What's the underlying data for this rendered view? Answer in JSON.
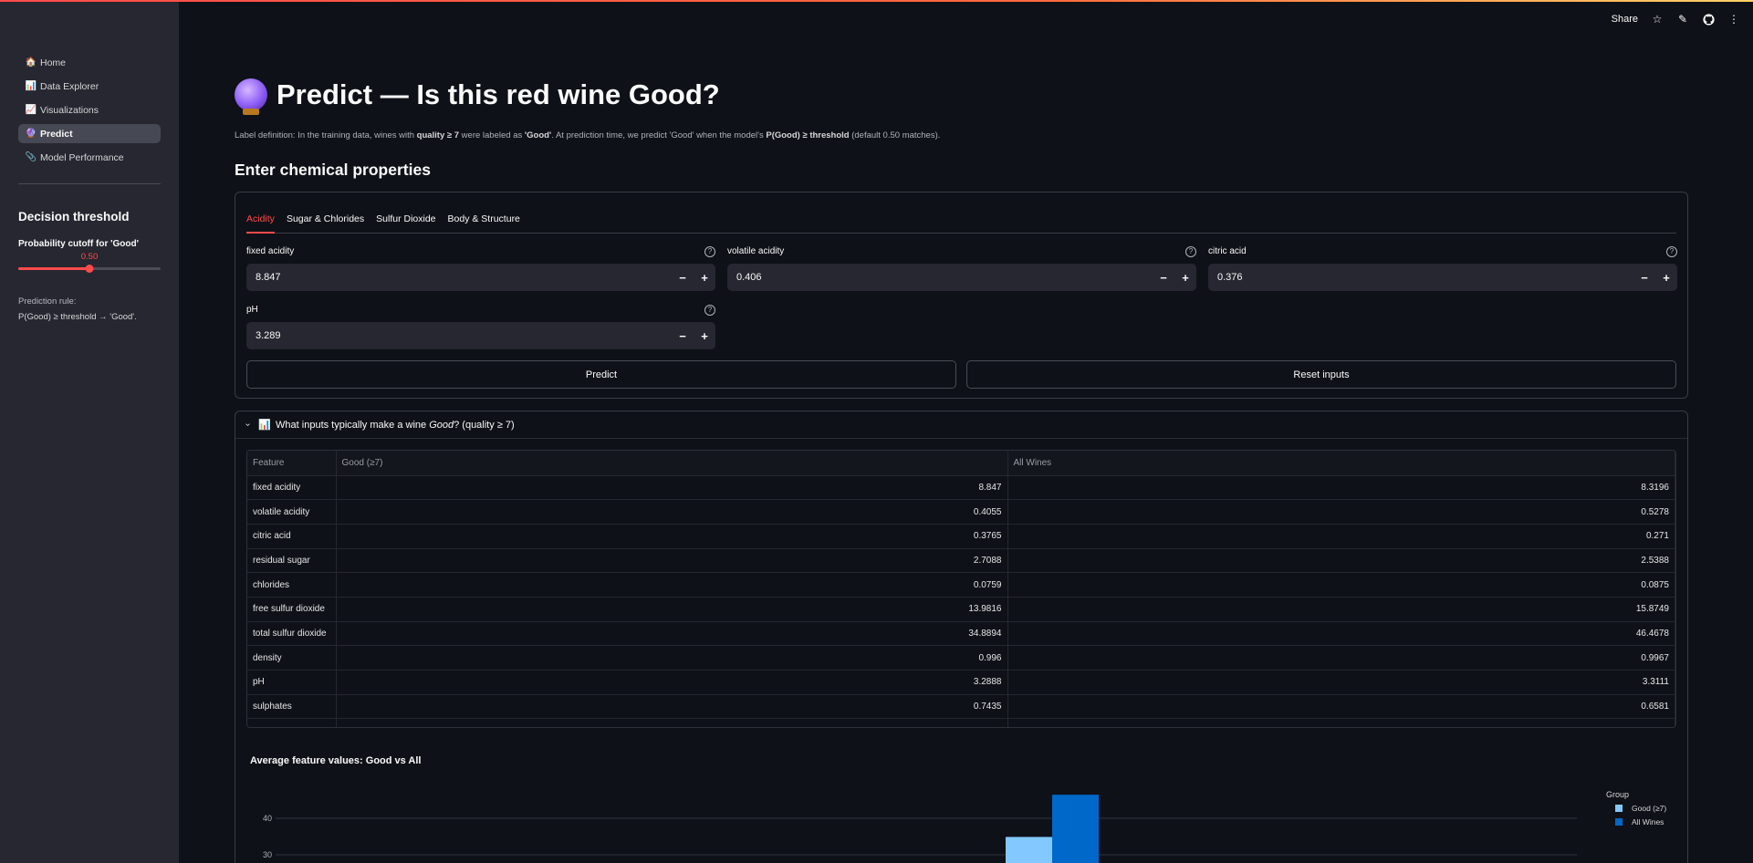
{
  "sidebar": {
    "nav": [
      {
        "label": "Home",
        "icon": "🏠",
        "active": false
      },
      {
        "label": "Data Explorer",
        "icon": "📊",
        "active": false
      },
      {
        "label": "Visualizations",
        "icon": "📈",
        "active": false
      },
      {
        "label": "Predict",
        "icon": "🔮",
        "active": true
      },
      {
        "label": "Model Performance",
        "icon": "📎",
        "active": false
      }
    ],
    "heading": "Decision threshold",
    "slider_label": "Probability cutoff for 'Good'",
    "slider_value": "0.50",
    "slider_fraction": 0.5,
    "rule_label": "Prediction rule:",
    "rule_text": "P(Good) ≥ threshold → 'Good'."
  },
  "toolbar": {
    "share_label": "Share"
  },
  "main": {
    "title": "Predict — Is this red wine Good?",
    "label_def": {
      "p1": "Label definition: In the training data, wines with ",
      "b1": "quality ≥ 7",
      "p2": " were labeled as ",
      "b2": "'Good'",
      "p3": ". At prediction time, we predict 'Good' when the model's ",
      "b3": "P(Good) ≥ threshold",
      "p4": " (default 0.50 matches)."
    },
    "section_heading": "Enter chemical properties",
    "tabs": [
      "Acidity",
      "Sugar & Chlorides",
      "Sulfur Dioxide",
      "Body & Structure"
    ],
    "fields": [
      {
        "label": "fixed acidity",
        "value": "8.847"
      },
      {
        "label": "volatile acidity",
        "value": "0.406"
      },
      {
        "label": "citric acid",
        "value": "0.376"
      },
      {
        "label": "pH",
        "value": "3.289"
      }
    ],
    "predict_label": "Predict",
    "reset_label": "Reset inputs",
    "expander": {
      "icon": "📊",
      "p1": "What inputs typically make a wine ",
      "em": "Good",
      "p2": "? (quality ≥ 7)"
    },
    "table": {
      "headers": [
        "Feature",
        "Good (≥7)",
        "All Wines"
      ],
      "rows": [
        [
          "fixed acidity",
          "8.847",
          "8.3196"
        ],
        [
          "volatile acidity",
          "0.4055",
          "0.5278"
        ],
        [
          "citric acid",
          "0.3765",
          "0.271"
        ],
        [
          "residual sugar",
          "2.7088",
          "2.5388"
        ],
        [
          "chlorides",
          "0.0759",
          "0.0875"
        ],
        [
          "free sulfur dioxide",
          "13.9816",
          "15.8749"
        ],
        [
          "total sulfur dioxide",
          "34.8894",
          "46.4678"
        ],
        [
          "density",
          "0.996",
          "0.9967"
        ],
        [
          "pH",
          "3.2888",
          "3.3111"
        ],
        [
          "sulphates",
          "0.7435",
          "0.6581"
        ]
      ]
    },
    "chart_title": "Average feature values: Good vs All"
  },
  "chart_data": {
    "type": "bar",
    "title": "Average feature values: Good vs All",
    "y_ticks": [
      "40",
      "30"
    ],
    "visible_bars": [
      {
        "series": "Good (≥7)",
        "value": 34.8894
      },
      {
        "series": "All Wines",
        "value": 46.4678
      }
    ],
    "series": [
      {
        "name": "Good (≥7)",
        "color": "#83c9ff"
      },
      {
        "name": "All Wines",
        "color": "#0068c9"
      }
    ],
    "legend_title": "Group",
    "legend_position": "top-right"
  },
  "colors": {
    "accent": "#ff4b4b",
    "sidebar_bg": "#262730",
    "page_bg": "#0e1117"
  }
}
